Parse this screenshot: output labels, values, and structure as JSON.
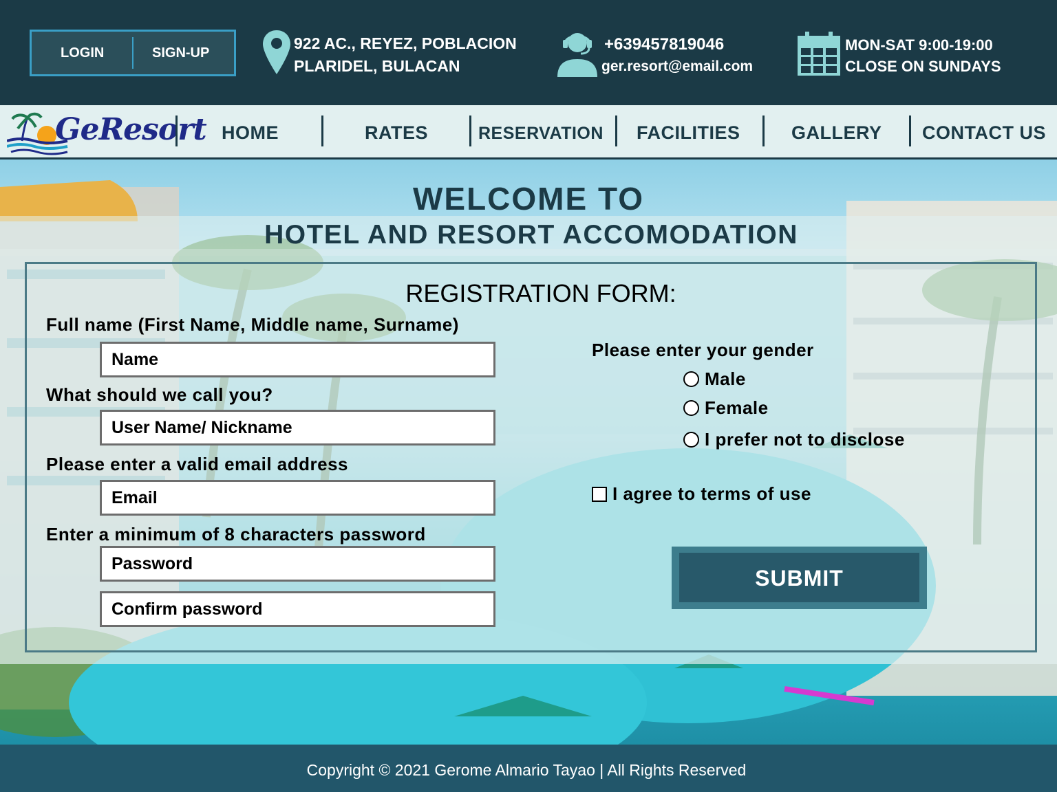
{
  "topbar": {
    "login_label": "LOGIN",
    "signup_label": "SIGN-UP",
    "address_line1": "922 AC., REYEZ, POBLACION",
    "address_line2": "PLARIDEL, BULACAN",
    "phone": "+639457819046",
    "email": "ger.resort@email.com",
    "hours_line1": "MON-SAT 9:00-19:00",
    "hours_line2": "CLOSE ON SUNDAYS",
    "icons": [
      "location-pin-icon",
      "support-agent-icon",
      "calendar-icon"
    ]
  },
  "nav": {
    "logo_text": "GeResort",
    "items": [
      "HOME",
      "RATES",
      "RESERVATION",
      "FACILITIES",
      "GALLERY",
      "CONTACT US"
    ]
  },
  "hero": {
    "welcome_line1": "WELCOME TO",
    "welcome_line2": "HOTEL AND RESORT ACCOMODATION"
  },
  "form": {
    "title": "REGISTRATION FORM:",
    "fullname_label": "Full name (First Name, Middle name, Surname)",
    "fullname_placeholder": "Name",
    "nickname_label": "What should we call you?",
    "nickname_placeholder": "User Name/ Nickname",
    "email_label": "Please enter a valid email address",
    "email_placeholder": "Email",
    "password_label": "Enter a minimum of 8 characters password",
    "password_placeholder": "Password",
    "confirm_placeholder": "Confirm password",
    "gender_label": "Please enter your gender",
    "gender_options": [
      "Male",
      "Female",
      "I prefer not to disclose"
    ],
    "terms_label": "I agree to terms of use",
    "submit_label": "SUBMIT"
  },
  "footer": {
    "copyright": "Copyright © 2021 Gerome Almario Tayao | All Rights Reserved"
  },
  "colors": {
    "header_dark": "#1b3a46",
    "nav_bg": "#e2f0f0",
    "accent_blue": "#3a9fc6",
    "submit_bg": "#28596a",
    "footer_bg": "#22566a"
  }
}
